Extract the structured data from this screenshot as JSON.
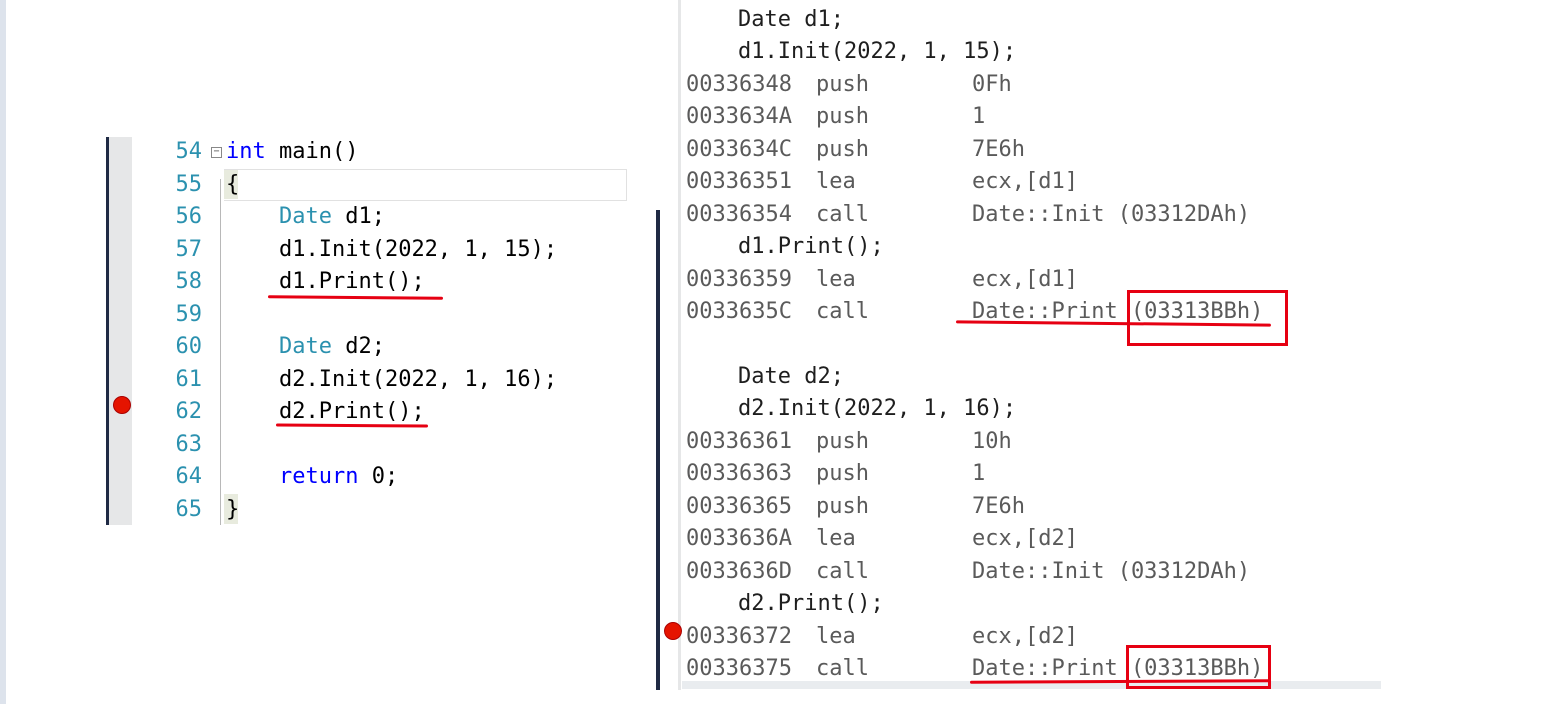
{
  "source_editor": {
    "lines": [
      {
        "number": "54",
        "code": "int main()"
      },
      {
        "number": "55",
        "code": "{"
      },
      {
        "number": "56",
        "code": "    Date d1;"
      },
      {
        "number": "57",
        "code": "    d1.Init(2022, 1, 15);"
      },
      {
        "number": "58",
        "code": "    d1.Print();"
      },
      {
        "number": "59",
        "code": ""
      },
      {
        "number": "60",
        "code": "    Date d2;"
      },
      {
        "number": "61",
        "code": "    d2.Init(2022, 1, 16);"
      },
      {
        "number": "62",
        "code": "    d2.Print();"
      },
      {
        "number": "63",
        "code": ""
      },
      {
        "number": "64",
        "code": "    return 0;"
      },
      {
        "number": "65",
        "code": "}"
      }
    ],
    "breakpoint_line": "62"
  },
  "disassembly": {
    "rows": [
      {
        "kind": "source",
        "text": "Date d1;"
      },
      {
        "kind": "source",
        "text": "d1.Init(2022, 1, 15);"
      },
      {
        "kind": "asm",
        "address": "00336348",
        "op": "push",
        "arg": "0Fh"
      },
      {
        "kind": "asm",
        "address": "0033634A",
        "op": "push",
        "arg": "1"
      },
      {
        "kind": "asm",
        "address": "0033634C",
        "op": "push",
        "arg": "7E6h"
      },
      {
        "kind": "asm",
        "address": "00336351",
        "op": "lea",
        "arg": "ecx,[d1]"
      },
      {
        "kind": "asm",
        "address": "00336354",
        "op": "call",
        "arg": "Date::Init (03312DAh)"
      },
      {
        "kind": "source",
        "text": "d1.Print();"
      },
      {
        "kind": "asm",
        "address": "00336359",
        "op": "lea",
        "arg": "ecx,[d1]"
      },
      {
        "kind": "asm",
        "address": "0033635C",
        "op": "call",
        "arg": "Date::Print (03313BBh)"
      },
      {
        "kind": "blank",
        "text": ""
      },
      {
        "kind": "source",
        "text": "Date d2;"
      },
      {
        "kind": "source",
        "text": "d2.Init(2022, 1, 16);"
      },
      {
        "kind": "asm",
        "address": "00336361",
        "op": "push",
        "arg": "10h"
      },
      {
        "kind": "asm",
        "address": "00336363",
        "op": "push",
        "arg": "1"
      },
      {
        "kind": "asm",
        "address": "00336365",
        "op": "push",
        "arg": "7E6h"
      },
      {
        "kind": "asm",
        "address": "0033636A",
        "op": "lea",
        "arg": "ecx,[d2]"
      },
      {
        "kind": "asm",
        "address": "0033636D",
        "op": "call",
        "arg": "Date::Init (03312DAh)"
      },
      {
        "kind": "source",
        "text": "d2.Print();"
      },
      {
        "kind": "asm",
        "address": "00336372",
        "op": "lea",
        "arg": "ecx,[d2]"
      },
      {
        "kind": "asm",
        "address": "00336375",
        "op": "call",
        "arg": "Date::Print (03313BBh)"
      }
    ],
    "breakpoint_address": "00336372"
  },
  "colors": {
    "line_number": "#2b91af",
    "keyword": "#0000ff",
    "type_name": "#2b91af",
    "annotation_red": "#e60012",
    "breakpoint": "#e51400"
  }
}
